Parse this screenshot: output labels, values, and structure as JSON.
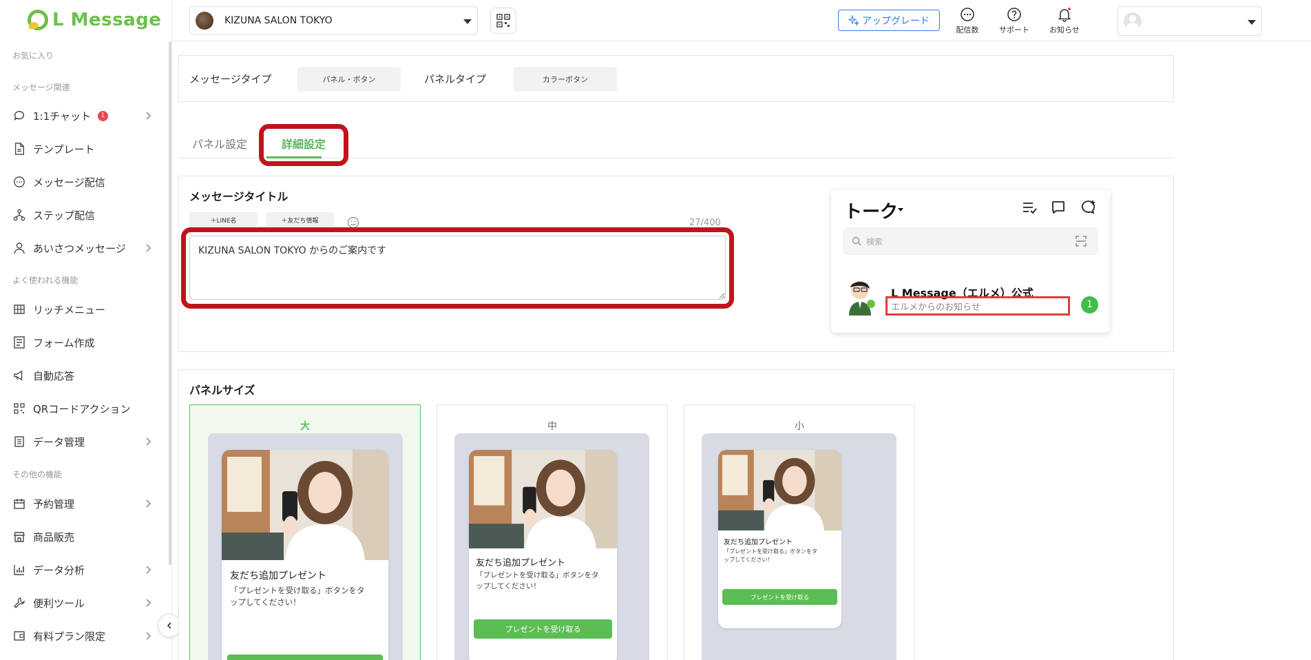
{
  "brand": {
    "logo_text": "L Message",
    "accent": "#6cc04a"
  },
  "sidebar": {
    "sections": [
      "お気に入り",
      "メッセージ関連",
      "よく使われる機能",
      "その他の機能"
    ],
    "items": [
      {
        "label": "1:1チャット",
        "badge": "1",
        "icon": "chat-bubble-icon",
        "has_arrow": true
      },
      {
        "label": "テンプレート",
        "icon": "document-icon"
      },
      {
        "label": "メッセージ配信",
        "icon": "message-icon"
      },
      {
        "label": "ステップ配信",
        "icon": "flow-icon"
      },
      {
        "label": "あいさつメッセージ",
        "icon": "user-icon",
        "has_arrow": true
      },
      {
        "label": "リッチメニュー",
        "icon": "grid-icon"
      },
      {
        "label": "フォーム作成",
        "icon": "form-icon"
      },
      {
        "label": "自動応答",
        "icon": "megaphone-icon"
      },
      {
        "label": "QRコードアクション",
        "icon": "qr-icon"
      },
      {
        "label": "データ管理",
        "icon": "database-icon",
        "has_arrow": true
      },
      {
        "label": "予約管理",
        "icon": "calendar-icon",
        "has_arrow": true
      },
      {
        "label": "商品販売",
        "icon": "store-icon"
      },
      {
        "label": "データ分析",
        "icon": "bar-chart-icon",
        "has_arrow": true
      },
      {
        "label": "便利ツール",
        "icon": "wrench-icon",
        "has_arrow": true
      },
      {
        "label": "有料プラン限定",
        "icon": "wallet-icon",
        "has_arrow": true
      }
    ]
  },
  "header": {
    "account_name": "KIZUNA SALON TOKYO",
    "upgrade_label": "アップグレード",
    "icons": [
      {
        "label": "配信数",
        "icon": "chat-dots-icon"
      },
      {
        "label": "サポート",
        "icon": "question-icon"
      },
      {
        "label": "お知らせ",
        "icon": "bell-icon"
      }
    ]
  },
  "message_type": {
    "type_label": "メッセージタイプ",
    "type_value": "パネル・ボタン",
    "panel_label": "パネルタイプ",
    "panel_value": "カラーボタン"
  },
  "tabs": [
    {
      "label": "パネル設定",
      "active": false
    },
    {
      "label": "詳細設定",
      "active": true
    }
  ],
  "title_section": {
    "heading": "メッセージタイトル",
    "btn_line_name": "＋LINE名",
    "btn_friend_info": "＋友だち情報",
    "counter": "27/400",
    "value": "KIZUNA SALON TOKYO からのご案内です"
  },
  "line_preview": {
    "title": "トーク",
    "search_placeholder": "検索",
    "chat_name": "L Message（エルメ）公式",
    "chat_message": "エルメからのお知らせ",
    "unread": "1"
  },
  "panel_size": {
    "heading": "パネルサイズ",
    "options": [
      {
        "label": "大",
        "selected": true
      },
      {
        "label": "中",
        "selected": false
      },
      {
        "label": "小",
        "selected": false
      }
    ],
    "card_title": "友だち追加プレゼント",
    "card_desc_1": "「プレゼントを受け取る」ボタンをタ",
    "card_desc_2": "ップしてください！",
    "card_button": "プレゼントを受け取る"
  },
  "colors": {
    "highlight": "#c0141b",
    "active_tab": "#5cb85c",
    "upgrade": "#2f7bea"
  }
}
